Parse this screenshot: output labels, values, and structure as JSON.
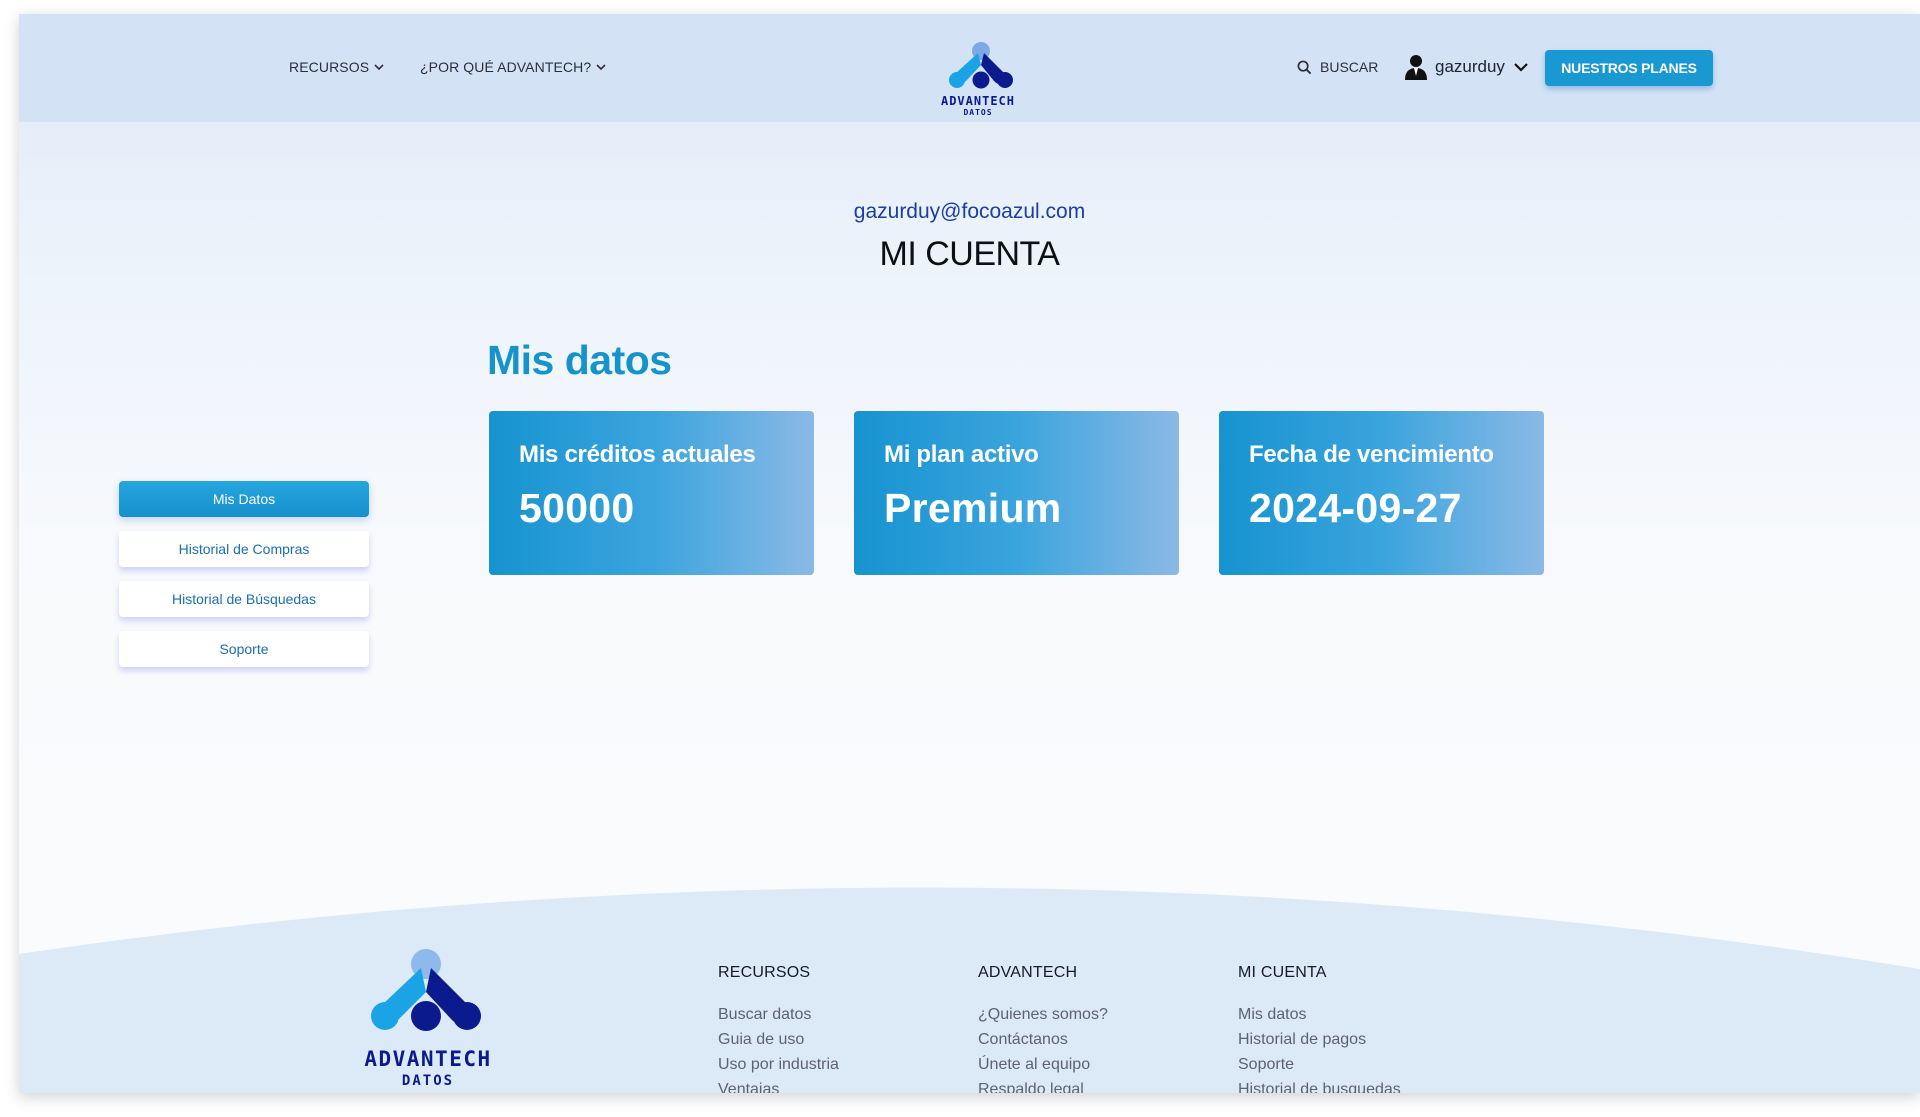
{
  "header": {
    "nav": [
      {
        "label": "RECURSOS"
      },
      {
        "label": "¿POR QUÉ ADVANTECH?"
      }
    ],
    "logo": {
      "brand": "ADVANTECH",
      "sub": "DATOS"
    },
    "search_label": "BUSCAR",
    "username": "gazurduy",
    "plans_button": "NUESTROS PLANES"
  },
  "account": {
    "email": "gazurduy@focoazul.com",
    "title": "MI CUENTA",
    "section_title": "Mis datos"
  },
  "side_menu": [
    {
      "label": "Mis Datos",
      "active": true
    },
    {
      "label": "Historial de Compras",
      "active": false
    },
    {
      "label": "Historial de Búsquedas",
      "active": false
    },
    {
      "label": "Soporte",
      "active": false
    }
  ],
  "cards": [
    {
      "label": "Mis créditos actuales",
      "value": "50000"
    },
    {
      "label": "Mi plan activo",
      "value": "Premium"
    },
    {
      "label": "Fecha de vencimiento",
      "value": "2024-09-27"
    }
  ],
  "footer": {
    "logo": {
      "brand": "ADVANTECH",
      "sub": "DATOS"
    },
    "columns": [
      {
        "title": "RECURSOS",
        "links": [
          "Buscar datos",
          "Guia de uso",
          "Uso por industria",
          "Ventajas"
        ]
      },
      {
        "title": "ADVANTECH",
        "links": [
          "¿Quienes somos?",
          "Contáctanos",
          "Únete al equipo",
          "Respaldo legal"
        ]
      },
      {
        "title": "MI CUENTA",
        "links": [
          "Mis datos",
          "Historial de pagos",
          "Soporte",
          "Historial de busquedas"
        ]
      }
    ]
  },
  "colors": {
    "primary": "#1a98d2",
    "header_bg": "#d3e3f5",
    "logo_dark": "#0b1a8c",
    "logo_light": "#1aa4e6",
    "email": "#1c3ea0"
  },
  "icons": {
    "search": "search-icon",
    "user": "user-icon",
    "chevron": "chevron-down-icon"
  }
}
